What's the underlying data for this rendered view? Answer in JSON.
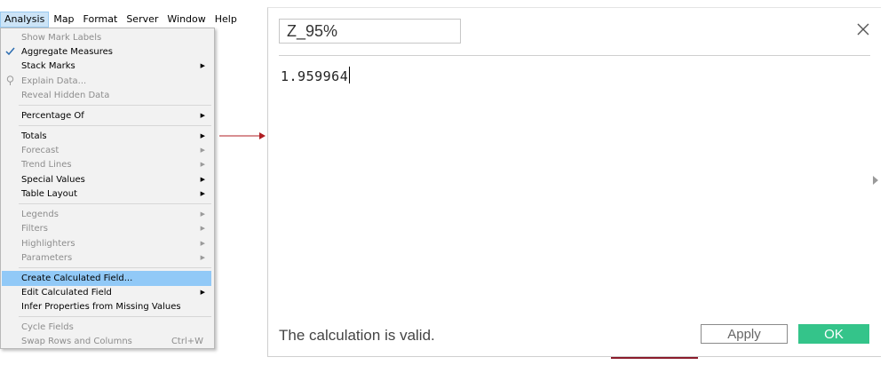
{
  "menubar": {
    "items": [
      {
        "label": "Analysis"
      },
      {
        "label": "Map"
      },
      {
        "label": "Format"
      },
      {
        "label": "Server"
      },
      {
        "label": "Window"
      },
      {
        "label": "Help"
      }
    ]
  },
  "analysis_menu": {
    "items": [
      {
        "label": "Show Mark Labels",
        "disabled": true
      },
      {
        "label": "Aggregate Measures",
        "checked": true,
        "icon": "checkmark-icon"
      },
      {
        "label": "Stack Marks",
        "submenu": true
      },
      {
        "label": "Explain Data...",
        "disabled": true,
        "icon": "lightbulb-icon"
      },
      {
        "label": "Reveal Hidden Data",
        "disabled": true
      },
      {
        "label": "Percentage Of",
        "submenu": true
      },
      {
        "label": "Totals",
        "submenu": true
      },
      {
        "label": "Forecast",
        "disabled": true,
        "submenu": true
      },
      {
        "label": "Trend Lines",
        "disabled": true,
        "submenu": true
      },
      {
        "label": "Special Values",
        "submenu": true
      },
      {
        "label": "Table Layout",
        "submenu": true
      },
      {
        "label": "Legends",
        "disabled": true,
        "submenu": true
      },
      {
        "label": "Filters",
        "disabled": true,
        "submenu": true
      },
      {
        "label": "Highlighters",
        "disabled": true,
        "submenu": true
      },
      {
        "label": "Parameters",
        "disabled": true,
        "submenu": true
      },
      {
        "label": "Create Calculated Field...",
        "highlighted": true
      },
      {
        "label": "Edit Calculated Field",
        "submenu": true
      },
      {
        "label": "Infer Properties from Missing Values"
      },
      {
        "label": "Cycle Fields",
        "disabled": true
      },
      {
        "label": "Swap Rows and Columns",
        "disabled": true,
        "shortcut": "Ctrl+W"
      }
    ]
  },
  "connector_color": "#b01e23",
  "calc_editor": {
    "name_value": "Z_95%",
    "formula": "1.959964",
    "status": "The calculation is valid.",
    "apply_label": "Apply",
    "ok_label": "OK",
    "ok_color": "#34c48a"
  }
}
